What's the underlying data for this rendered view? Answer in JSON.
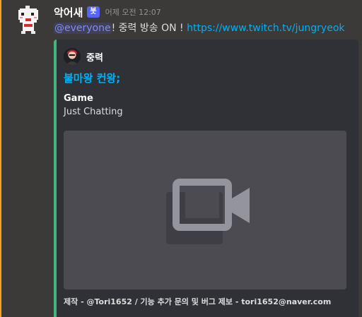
{
  "message": {
    "author": "악어새",
    "bot_tag": "봇",
    "timestamp": "어제 오전 12:07",
    "mention": "@everyone",
    "text": "! 중력 방송 ON ! ",
    "link": "https://www.twitch.tv/jungryeok"
  },
  "embed": {
    "author_name": "중력",
    "title": "불마왕 컨왕;",
    "field": {
      "name": "Game",
      "value": "Just Chatting"
    },
    "footer": "제작 - @Tori1652 / 기능 추가 문의 및 버그 제보 - tori1652@naver.com",
    "accent_color": "#43b581"
  },
  "colors": {
    "highlight": "#faa61a",
    "link": "#00b0f4",
    "bot_tag": "#5865f2"
  },
  "icons": [
    "bot-avatar-icon",
    "author-avatar-icon",
    "video-camera-icon"
  ]
}
